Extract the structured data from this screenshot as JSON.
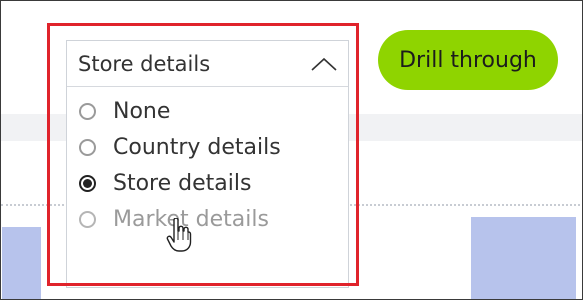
{
  "filter_dropdown": {
    "selected_value": "Store details",
    "options": [
      {
        "label": "None",
        "checked": false
      },
      {
        "label": "Country details",
        "checked": false
      },
      {
        "label": "Store details",
        "checked": true
      },
      {
        "label": "Market details",
        "checked": false,
        "hovered": true
      }
    ]
  },
  "toolbar": {
    "drill_through_label": "Drill through"
  },
  "colors": {
    "highlight_border": "#e0232b",
    "drill_button": "#8fd400",
    "chart_bar": "#b7c3ec"
  },
  "icons": {
    "dropdown_toggle": "chevron-up-icon",
    "pointer": "hand-pointer-icon"
  }
}
